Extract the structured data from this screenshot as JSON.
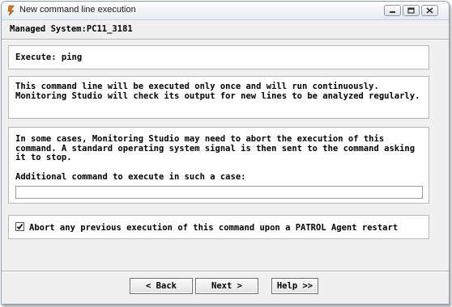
{
  "window": {
    "title": "New command line execution",
    "icon": "app-icon"
  },
  "header": {
    "managed_system": "Managed System:PC11_3181"
  },
  "execute": {
    "text": "Execute: ping"
  },
  "info": {
    "text": "This command line will be executed only once and will run continuously.\nMonitoring Studio will check its output for new lines to be analyzed regularly."
  },
  "abort": {
    "description": "In some cases, Monitoring Studio may need to abort the execution of this\ncommand. A standard operating system signal is then sent to the command asking\nit to stop.",
    "label": "Additional command to execute in such a case:",
    "value": ""
  },
  "restart_option": {
    "label": "Abort any previous execution of this command upon a PATROL Agent restart",
    "checked": true
  },
  "buttons": {
    "back": "< Back",
    "next": "Next >",
    "help": "Help >>"
  }
}
